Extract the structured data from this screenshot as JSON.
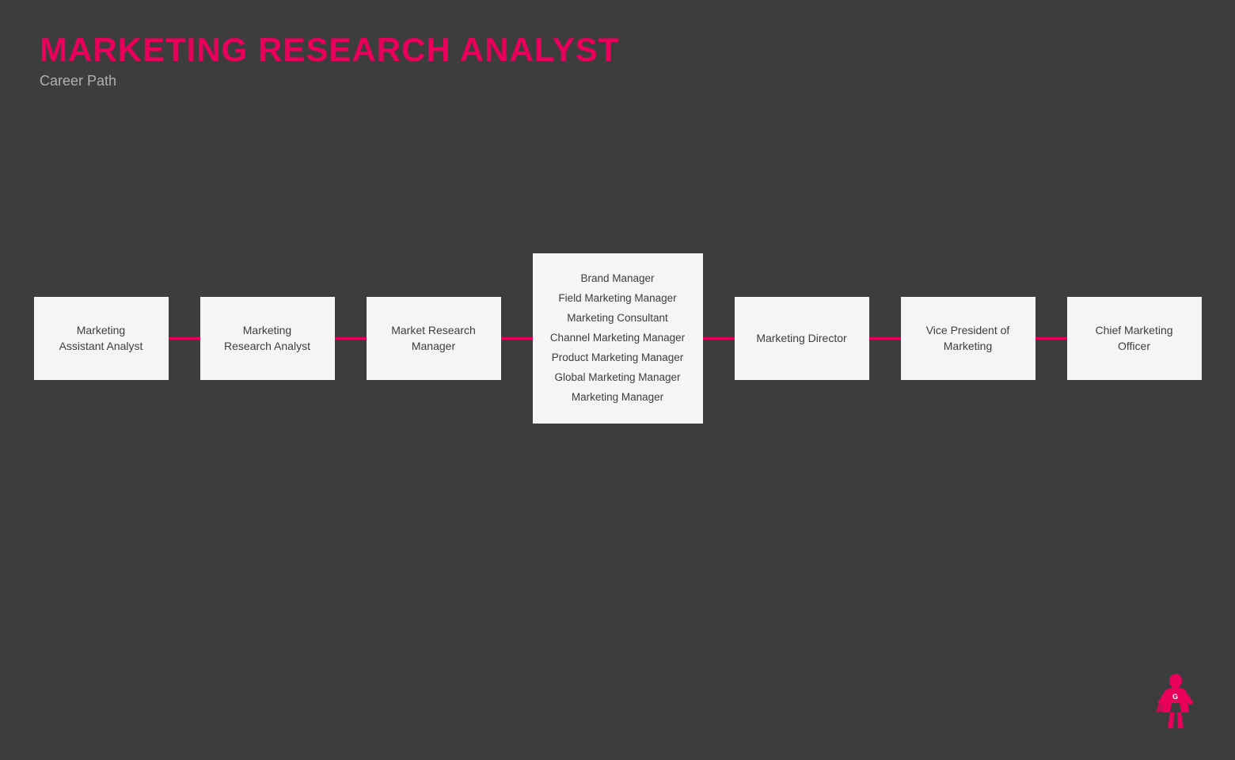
{
  "header": {
    "main_title": "MARKETING RESEARCH ANALYST",
    "subtitle": "Career Path"
  },
  "colors": {
    "accent": "#e8005a",
    "background": "#3d3d3d",
    "node_bg": "#f5f5f5",
    "node_text": "#3d3d3d",
    "subtitle_color": "#b0b0b0"
  },
  "nodes": [
    {
      "id": "node-1",
      "type": "single",
      "lines": [
        "Marketing",
        "Assistant Analyst"
      ]
    },
    {
      "id": "node-2",
      "type": "single",
      "lines": [
        "Marketing",
        "Research Analyst"
      ]
    },
    {
      "id": "node-3",
      "type": "single",
      "lines": [
        "Market Research",
        "Manager"
      ]
    },
    {
      "id": "node-4",
      "type": "multi",
      "lines": [
        "Brand Manager",
        "Field Marketing Manager",
        "Marketing Consultant",
        "Channel Marketing Manager",
        "Product Marketing Manager",
        "Global Marketing Manager",
        "Marketing Manager"
      ]
    },
    {
      "id": "node-5",
      "type": "single",
      "lines": [
        "Marketing Director"
      ]
    },
    {
      "id": "node-6",
      "type": "single",
      "lines": [
        "Vice President of",
        "Marketing"
      ]
    },
    {
      "id": "node-7",
      "type": "single",
      "lines": [
        "Chief Marketing",
        "Officer"
      ]
    }
  ]
}
